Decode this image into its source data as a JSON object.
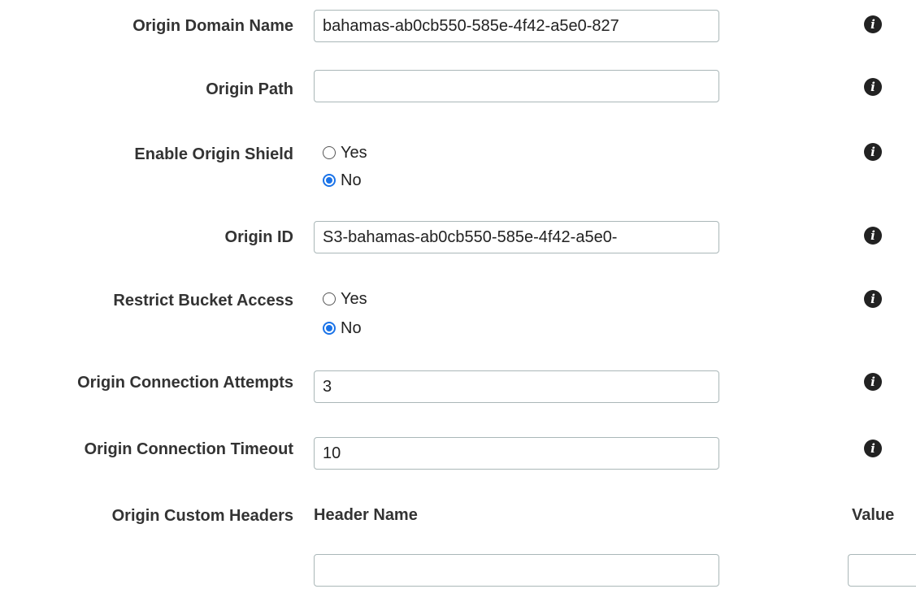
{
  "fields": {
    "origin_domain_name": {
      "label": "Origin Domain Name",
      "value": "bahamas-ab0cb550-585e-4f42-a5e0-827"
    },
    "origin_path": {
      "label": "Origin Path",
      "value": ""
    },
    "enable_origin_shield": {
      "label": "Enable Origin Shield",
      "options": [
        "Yes",
        "No"
      ],
      "selected": "No"
    },
    "origin_id": {
      "label": "Origin ID",
      "value": "S3-bahamas-ab0cb550-585e-4f42-a5e0-"
    },
    "restrict_bucket_access": {
      "label": "Restrict Bucket Access",
      "options": [
        "Yes",
        "No"
      ],
      "selected": "No"
    },
    "origin_connection_attempts": {
      "label": "Origin Connection Attempts",
      "value": "3"
    },
    "origin_connection_timeout": {
      "label": "Origin Connection Timeout",
      "value": "10"
    },
    "origin_custom_headers": {
      "label": "Origin Custom Headers",
      "header_name_label": "Header Name",
      "value_label": "Value",
      "header_name_value": "",
      "value_value": ""
    }
  },
  "icons": {
    "info": "info-icon",
    "info_glyph": "i"
  },
  "colors": {
    "label": "#333333",
    "radio_selected": "#1a73e8",
    "input_border": "#aab7b8"
  }
}
